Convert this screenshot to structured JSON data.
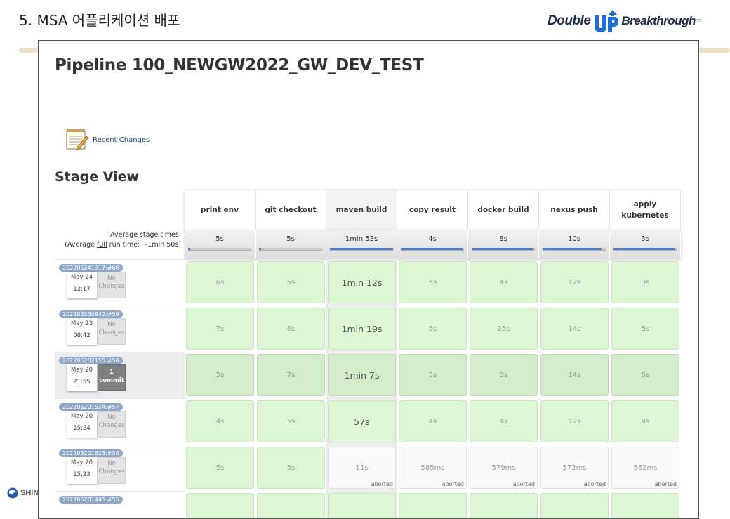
{
  "slide": {
    "title": "5. MSA 어플리케이션 배포"
  },
  "logo": {
    "word1": "Double",
    "word2": "Breakthrough",
    "tail": "="
  },
  "corner": {
    "text": "SHIN"
  },
  "jenkins": {
    "pipeline_title": "Pipeline 100_NEWGW2022_GW_DEV_TEST",
    "recent_changes": "Recent Changes",
    "stage_view_title": "Stage View",
    "avg_label_line1": "Average stage times:",
    "avg_label_pre": "(Average ",
    "avg_label_link": "full",
    "avg_label_post": " run time: ~1min 50s)",
    "stages": [
      {
        "name": "print env",
        "avg": "5s",
        "fill": 0.03
      },
      {
        "name": "git checkout",
        "avg": "5s",
        "fill": 0.03
      },
      {
        "name": "maven build",
        "avg": "1min 53s",
        "fill": 1.0
      },
      {
        "name": "copy result",
        "avg": "4s",
        "fill": 0.98
      },
      {
        "name": "docker build",
        "avg": "8s",
        "fill": 0.97
      },
      {
        "name": "nexus push",
        "avg": "10s",
        "fill": 0.93
      },
      {
        "name": "apply kubernetes",
        "avg": "3s",
        "fill": 0.97
      }
    ],
    "runs": [
      {
        "badge": "202205241317:#60",
        "date": "May 24",
        "time": "13:17",
        "changes": "No Changes",
        "commit": false,
        "cells": [
          {
            "t": "6s",
            "s": "ok"
          },
          {
            "t": "5s",
            "s": "ok"
          },
          {
            "t": "1min 12s",
            "s": "ok"
          },
          {
            "t": "5s",
            "s": "ok"
          },
          {
            "t": "4s",
            "s": "ok"
          },
          {
            "t": "12s",
            "s": "ok"
          },
          {
            "t": "3s",
            "s": "ok"
          }
        ]
      },
      {
        "badge": "202205230842:#59",
        "date": "May 23",
        "time": "08:42",
        "changes": "No Changes",
        "commit": false,
        "cells": [
          {
            "t": "7s",
            "s": "ok"
          },
          {
            "t": "6s",
            "s": "ok"
          },
          {
            "t": "1min 19s",
            "s": "ok"
          },
          {
            "t": "5s",
            "s": "ok"
          },
          {
            "t": "25s",
            "s": "ok"
          },
          {
            "t": "14s",
            "s": "ok"
          },
          {
            "t": "5s",
            "s": "ok"
          }
        ]
      },
      {
        "badge": "202205202155:#58",
        "date": "May 20",
        "time": "21:55",
        "changes_count": "1",
        "changes_word": "commit",
        "commit": true,
        "cells": [
          {
            "t": "5s",
            "s": "ok"
          },
          {
            "t": "7s",
            "s": "ok"
          },
          {
            "t": "1min 7s",
            "s": "ok"
          },
          {
            "t": "5s",
            "s": "ok"
          },
          {
            "t": "5s",
            "s": "ok"
          },
          {
            "t": "14s",
            "s": "ok"
          },
          {
            "t": "5s",
            "s": "ok"
          }
        ]
      },
      {
        "badge": "202205201524:#57",
        "date": "May 20",
        "time": "15:24",
        "changes": "No Changes",
        "commit": false,
        "cells": [
          {
            "t": "4s",
            "s": "ok"
          },
          {
            "t": "5s",
            "s": "ok"
          },
          {
            "t": "57s",
            "s": "ok"
          },
          {
            "t": "4s",
            "s": "ok"
          },
          {
            "t": "4s",
            "s": "ok"
          },
          {
            "t": "12s",
            "s": "ok"
          },
          {
            "t": "4s",
            "s": "ok"
          }
        ]
      },
      {
        "badge": "202205201523:#56",
        "date": "May 20",
        "time": "15:23",
        "changes": "No Changes",
        "commit": false,
        "cells": [
          {
            "t": "5s",
            "s": "ok"
          },
          {
            "t": "5s",
            "s": "ok"
          },
          {
            "t": "11s",
            "s": "ab"
          },
          {
            "t": "585ms",
            "s": "ab"
          },
          {
            "t": "579ms",
            "s": "ab"
          },
          {
            "t": "572ms",
            "s": "ab"
          },
          {
            "t": "562ms",
            "s": "ab"
          }
        ]
      },
      {
        "badge": "202205201445:#55",
        "date": "",
        "time": "",
        "changes": "",
        "commit": false,
        "cells": [
          {
            "t": "",
            "s": "ok"
          },
          {
            "t": "",
            "s": "ok"
          },
          {
            "t": "",
            "s": "ok"
          },
          {
            "t": "",
            "s": "ok"
          },
          {
            "t": "",
            "s": "ok"
          },
          {
            "t": "",
            "s": "ok"
          },
          {
            "t": "",
            "s": "ok"
          }
        ]
      }
    ],
    "aborted_label": "aborted"
  }
}
